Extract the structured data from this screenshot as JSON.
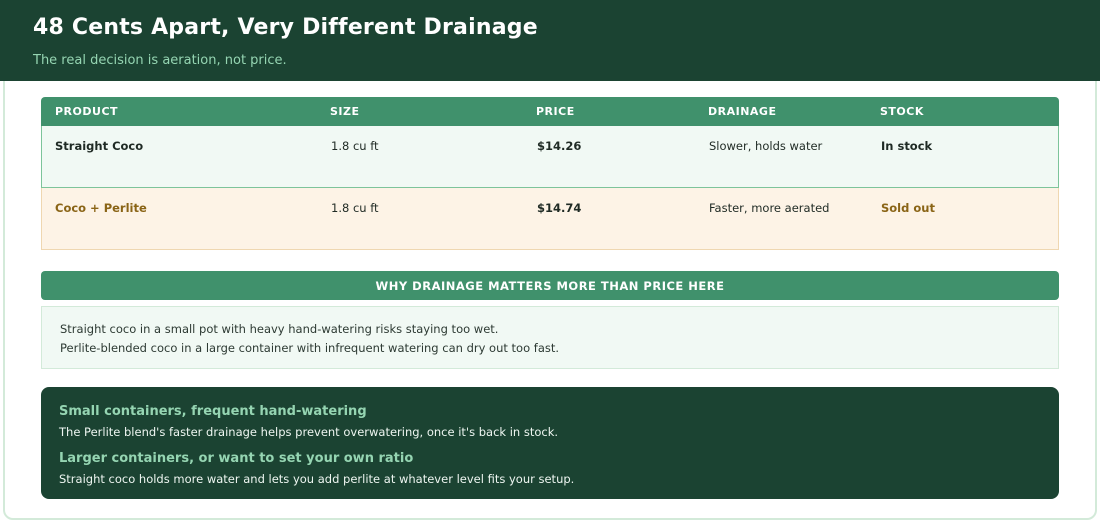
{
  "header": {
    "title": "48 Cents Apart, Very Different Drainage",
    "subtitle": "The real decision is aeration, not price."
  },
  "table": {
    "columns": [
      "PRODUCT",
      "SIZE",
      "PRICE",
      "DRAINAGE",
      "STOCK"
    ],
    "rows": [
      {
        "product": "Straight Coco",
        "size": "1.8 cu ft",
        "price": "$14.26",
        "drainage": "Slower, holds water",
        "stock": "In stock"
      },
      {
        "product": "Coco + Perlite",
        "size": "1.8 cu ft",
        "price": "$14.74",
        "drainage": "Faster, more aerated",
        "stock": "Sold out"
      }
    ]
  },
  "why": {
    "heading": "WHY DRAINAGE MATTERS MORE THAN PRICE HERE",
    "lines": [
      "Straight coco in a small pot with heavy hand-watering risks staying too wet.",
      "Perlite-blended coco in a large container with infrequent watering can dry out too fast."
    ]
  },
  "recommendations": [
    {
      "title": "Small containers, frequent hand-watering",
      "text": "The Perlite blend's faster drainage helps prevent overwatering, once it's back in stock."
    },
    {
      "title": "Larger containers, or want to set your own ratio",
      "text": "Straight coco holds more water and lets you add perlite at whatever level fits your setup."
    }
  ],
  "colors": {
    "header_bg": "#1b4332",
    "accent_green": "#40916c",
    "light_green": "#95d5b2",
    "sold_out": "#8a6416"
  }
}
